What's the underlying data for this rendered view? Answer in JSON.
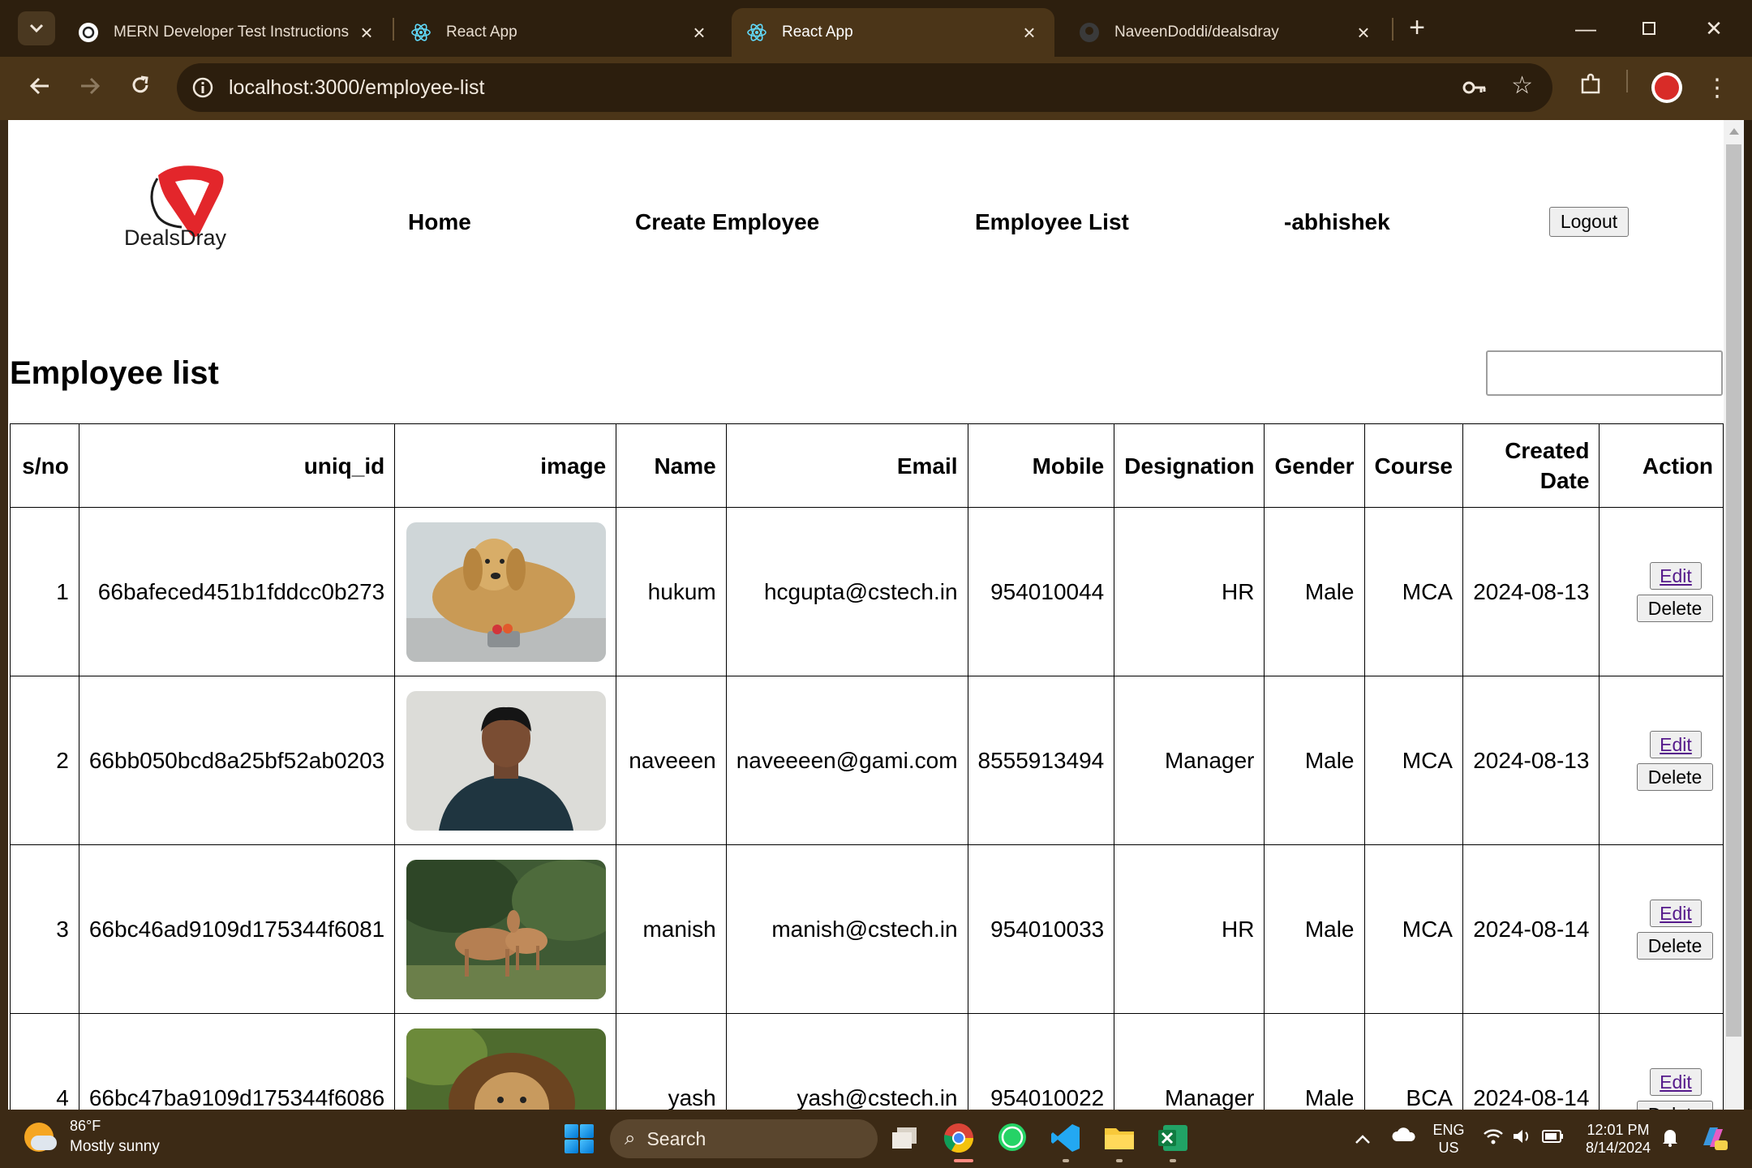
{
  "browser": {
    "tabs": [
      {
        "title": "MERN Developer Test Instructions",
        "icon": "openai-icon",
        "active": false
      },
      {
        "title": "React App",
        "icon": "react-icon",
        "active": false
      },
      {
        "title": "React App",
        "icon": "react-icon",
        "active": true
      },
      {
        "title": "NaveenDoddi/dealsdray",
        "icon": "github-icon",
        "active": false
      }
    ],
    "url": "localhost:3000/employee-list"
  },
  "header": {
    "logo_text": "DealsDray",
    "nav": {
      "home": "Home",
      "create": "Create Employee",
      "list": "Employee List",
      "user": "-abhishek"
    },
    "logout_label": "Logout"
  },
  "main": {
    "title": "Employee list",
    "search_value": "",
    "columns": [
      "s/no",
      "uniq_id",
      "image",
      "Name",
      "Email",
      "Mobile",
      "Designation",
      "Gender",
      "Course",
      "Created Date",
      "Action"
    ],
    "edit_label": "Edit",
    "delete_label": "Delete",
    "rows": [
      {
        "sno": "1",
        "uniq_id": "66bafeced451b1fddcc0b273",
        "image": "dog-photo",
        "name": "hukum",
        "email": "hcgupta@cstech.in",
        "mobile": "954010044",
        "designation": "HR",
        "gender": "Male",
        "course": "MCA",
        "created": "2024-08-13"
      },
      {
        "sno": "2",
        "uniq_id": "66bb050bcd8a25bf52ab0203",
        "image": "person-photo",
        "name": "naveeen",
        "email": "naveeeen@gami.com",
        "mobile": "8555913494",
        "designation": "Manager",
        "gender": "Male",
        "course": "MCA",
        "created": "2024-08-13"
      },
      {
        "sno": "3",
        "uniq_id": "66bc46ad9109d175344f6081",
        "image": "deer-photo",
        "name": "manish",
        "email": "manish@cstech.in",
        "mobile": "954010033",
        "designation": "HR",
        "gender": "Male",
        "course": "MCA",
        "created": "2024-08-14"
      },
      {
        "sno": "4",
        "uniq_id": "66bc47ba9109d175344f6086",
        "image": "lion-photo",
        "name": "yash",
        "email": "yash@cstech.in",
        "mobile": "954010022",
        "designation": "Manager",
        "gender": "Male",
        "course": "BCA",
        "created": "2024-08-14"
      }
    ]
  },
  "taskbar": {
    "weather_temp": "86°F",
    "weather_desc": "Mostly sunny",
    "search_label": "Search",
    "lang_1": "ENG",
    "lang_2": "US",
    "time": "12:01 PM",
    "date": "8/14/2024"
  }
}
